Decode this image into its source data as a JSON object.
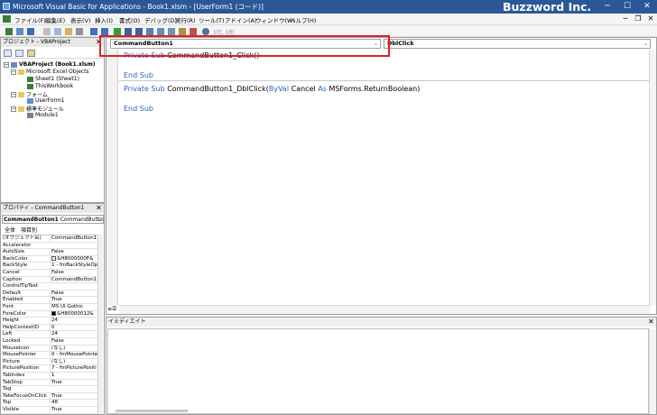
{
  "window": {
    "title": "Microsoft Visual Basic for Applications - Book1.xlsm - [UserForm1 (コード)]",
    "minimize": "─",
    "maximize": "☐",
    "close": "✕"
  },
  "watermark": "Buzzword Inc.",
  "menu": {
    "items": [
      "ファイル(F)",
      "編集(E)",
      "表示(V)",
      "挿入(I)",
      "書式(O)",
      "デバッグ(D)",
      "実行(R)",
      "ツール(T)",
      "アドイン(A)",
      "ウィンドウ(W)",
      "ヘルプ(H)"
    ]
  },
  "toolbar": {
    "position_text": "1行, 1桁"
  },
  "project": {
    "title": "プロジェクト - VBAProject",
    "close": "✕",
    "tree": [
      {
        "label": "VBAProject (Book1.xlsm)",
        "bold": true
      },
      {
        "label": "Microsoft Excel Objects"
      },
      {
        "label": "Sheet1 (Sheet1)"
      },
      {
        "label": "ThisWorkbook"
      },
      {
        "label": "フォーム"
      },
      {
        "label": "UserForm1"
      },
      {
        "label": "標準モジュール"
      },
      {
        "label": "Module1"
      }
    ]
  },
  "properties": {
    "title": "プロパティ - CommandButton1",
    "close": "✕",
    "object_name": "CommandButton1",
    "object_type": "CommandButton",
    "tabs": [
      "全体",
      "項目別"
    ],
    "rows": [
      {
        "name": "(オブジェクト名)",
        "value": "CommandButton1"
      },
      {
        "name": "Accelerator",
        "value": ""
      },
      {
        "name": "AutoSize",
        "value": "False"
      },
      {
        "name": "BackColor",
        "value": "&H8000000F&",
        "swatch": "#f0f0f0"
      },
      {
        "name": "BackStyle",
        "value": "1 - fmBackStyleOp"
      },
      {
        "name": "Cancel",
        "value": "False"
      },
      {
        "name": "Caption",
        "value": "CommandButton1"
      },
      {
        "name": "ControlTipText",
        "value": ""
      },
      {
        "name": "Default",
        "value": "False"
      },
      {
        "name": "Enabled",
        "value": "True"
      },
      {
        "name": "Font",
        "value": "MS UI Gothic"
      },
      {
        "name": "ForeColor",
        "value": "&H80000012&",
        "swatch": "#000000"
      },
      {
        "name": "Height",
        "value": "24"
      },
      {
        "name": "HelpContextID",
        "value": "0"
      },
      {
        "name": "Left",
        "value": "24"
      },
      {
        "name": "Locked",
        "value": "False"
      },
      {
        "name": "MouseIcon",
        "value": "(なし)"
      },
      {
        "name": "MousePointer",
        "value": "0 - fmMousePointe"
      },
      {
        "name": "Picture",
        "value": "(なし)"
      },
      {
        "name": "PicturePosition",
        "value": "7 - fmPicturePositi"
      },
      {
        "name": "TabIndex",
        "value": "1"
      },
      {
        "name": "TabStop",
        "value": "True"
      },
      {
        "name": "Tag",
        "value": ""
      },
      {
        "name": "TakeFocusOnClick",
        "value": "True"
      },
      {
        "name": "Top",
        "value": "48"
      },
      {
        "name": "Visible",
        "value": "True"
      }
    ]
  },
  "code": {
    "object_combo": "CommandButton1",
    "procedure_combo": "DblClick",
    "lines": [
      {
        "kind": "code",
        "parts": [
          {
            "t": "Private Sub ",
            "kw": true
          },
          {
            "t": "CommandButton1_Click()",
            "kw": false
          }
        ]
      },
      {
        "kind": "blank"
      },
      {
        "kind": "code",
        "parts": [
          {
            "t": "End Sub",
            "kw": true
          }
        ]
      },
      {
        "kind": "sep"
      },
      {
        "kind": "code",
        "parts": [
          {
            "t": "Private Sub ",
            "kw": true
          },
          {
            "t": "CommandButton1_DblClick(",
            "kw": false
          },
          {
            "t": "ByVal ",
            "kw": true
          },
          {
            "t": "Cancel ",
            "kw": false
          },
          {
            "t": "As ",
            "kw": true
          },
          {
            "t": "MSForms.ReturnBoolean)",
            "kw": false
          }
        ]
      },
      {
        "kind": "blank"
      },
      {
        "kind": "code",
        "parts": [
          {
            "t": "End Sub",
            "kw": true
          }
        ]
      }
    ]
  },
  "immediate": {
    "title": "イミディエイト",
    "close": "✕"
  },
  "colors": {
    "titlebar": "#2b5797",
    "keyword": "#2a64b4",
    "highlight": "#e02020"
  }
}
